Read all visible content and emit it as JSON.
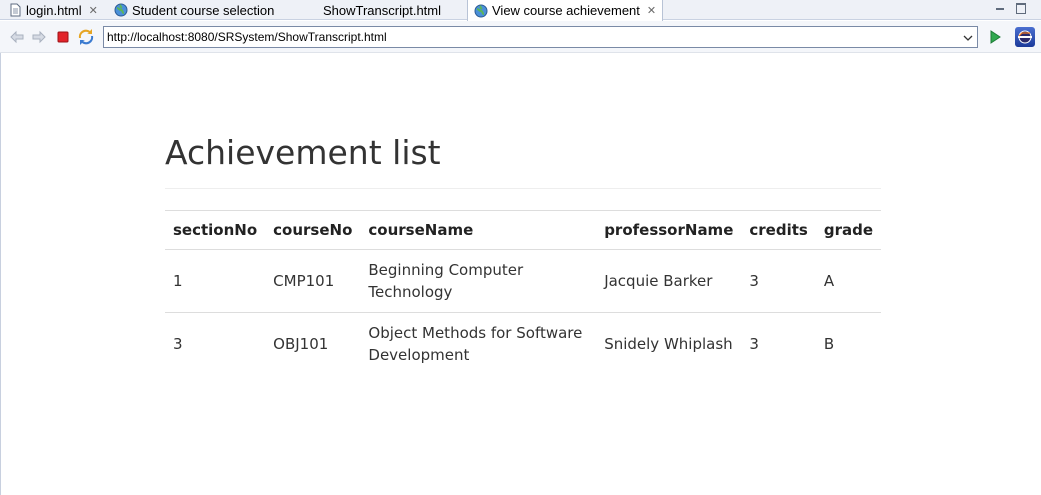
{
  "tabs": [
    {
      "label": "login.html",
      "icon": "file-icon",
      "active": false,
      "closable": true
    },
    {
      "label": "Student course selection",
      "icon": "globe-icon",
      "active": false,
      "closable": false
    },
    {
      "label": "ShowTranscript.html",
      "icon": "",
      "active": false,
      "closable": false
    },
    {
      "label": "View course achievement",
      "icon": "globe-icon",
      "active": true,
      "closable": true
    }
  ],
  "toolbar": {
    "back_icon": "back-arrow-icon",
    "forward_icon": "forward-arrow-icon",
    "stop_icon": "stop-icon",
    "refresh_icon": "refresh-icon",
    "go_icon": "go-arrow-icon",
    "prefs_icon": "eclipse-icon"
  },
  "address": {
    "url": "http://localhost:8080/SRSystem/ShowTranscript.html"
  },
  "page": {
    "title": "Achievement list",
    "table": {
      "headers": [
        "sectionNo",
        "courseNo",
        "courseName",
        "professorName",
        "credits",
        "grade"
      ],
      "rows": [
        [
          "1",
          "CMP101",
          "Beginning Computer Technology",
          "Jacquie Barker",
          "3",
          "A"
        ],
        [
          "3",
          "OBJ101",
          "Object Methods for Software Development",
          "Snidely Whiplash",
          "3",
          "B"
        ]
      ]
    }
  },
  "colors": {
    "tab_strip": "#eef1f7",
    "toolbar": "#f4f6fa",
    "stop_red": "#e2232a",
    "go_green": "#2fa84f",
    "heading_text": "#333333",
    "table_rule": "#dddddd"
  }
}
